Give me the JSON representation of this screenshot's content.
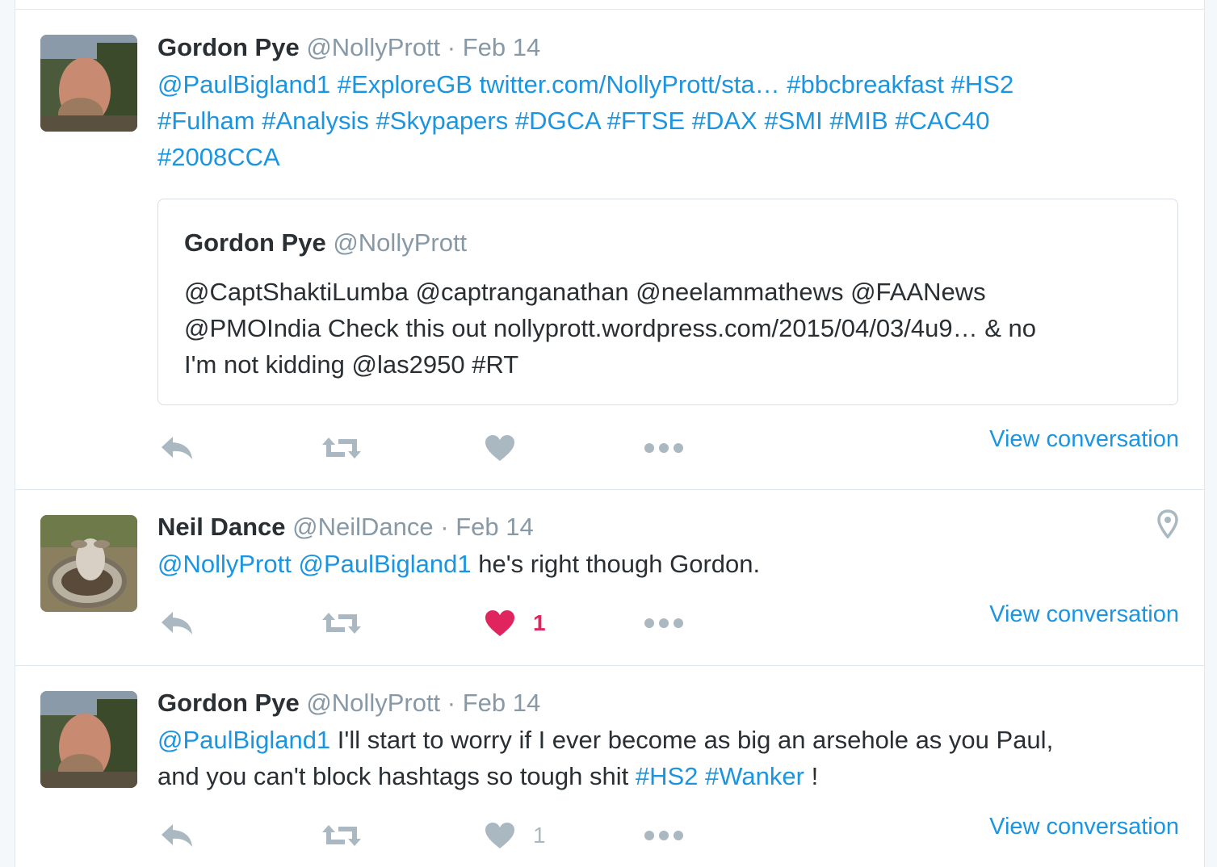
{
  "tweets": [
    {
      "fullname": "Gordon Pye",
      "username": "@NollyPrott",
      "separator": "·",
      "time": "Feb 14",
      "text_lines": [
        [
          {
            "t": "@PaulBigland1",
            "link": true
          },
          {
            "t": " ",
            "link": false
          },
          {
            "t": "#ExploreGB",
            "link": true
          },
          {
            "t": " ",
            "link": false
          },
          {
            "t": "twitter.com/NollyPrott/sta…",
            "link": true
          },
          {
            "t": " ",
            "link": false
          },
          {
            "t": "#bbcbreakfast",
            "link": true
          },
          {
            "t": " ",
            "link": false
          },
          {
            "t": "#HS2",
            "link": true
          }
        ],
        [
          {
            "t": "#Fulham",
            "link": true
          },
          {
            "t": " ",
            "link": false
          },
          {
            "t": "#Analysis",
            "link": true
          },
          {
            "t": " ",
            "link": false
          },
          {
            "t": "#Skypapers",
            "link": true
          },
          {
            "t": " ",
            "link": false
          },
          {
            "t": "#DGCA",
            "link": true
          },
          {
            "t": " ",
            "link": false
          },
          {
            "t": "#FTSE",
            "link": true
          },
          {
            "t": " ",
            "link": false
          },
          {
            "t": "#DAX",
            "link": true
          },
          {
            "t": " ",
            "link": false
          },
          {
            "t": "#SMI",
            "link": true
          },
          {
            "t": " ",
            "link": false
          },
          {
            "t": "#MIB",
            "link": true
          },
          {
            "t": " ",
            "link": false
          },
          {
            "t": "#CAC40",
            "link": true
          }
        ],
        [
          {
            "t": "#2008CCA",
            "link": true
          }
        ]
      ],
      "quote": {
        "fullname": "Gordon Pye",
        "username": "@NollyPrott",
        "lines": [
          "@CaptShaktiLumba @captranganathan @neelammathews @FAANews",
          "@PMOIndia Check this out nollyprott.wordpress.com/2015/04/03/4u9… & no",
          "I'm not kidding @las2950 #RT"
        ]
      },
      "like_count": "",
      "liked": false,
      "view_conversation": "View conversation"
    },
    {
      "fullname": "Neil Dance",
      "username": "@NeilDance",
      "separator": "·",
      "time": "Feb 14",
      "text_lines": [
        [
          {
            "t": "@NollyPrott",
            "link": true
          },
          {
            "t": " ",
            "link": false
          },
          {
            "t": "@PaulBigland1",
            "link": true
          },
          {
            "t": " he's right though Gordon.",
            "link": false
          }
        ]
      ],
      "like_count": "1",
      "liked": true,
      "has_location": true,
      "view_conversation": "View conversation"
    },
    {
      "fullname": "Gordon Pye",
      "username": "@NollyPrott",
      "separator": "·",
      "time": "Feb 14",
      "text_lines": [
        [
          {
            "t": "@PaulBigland1",
            "link": true
          },
          {
            "t": " I'll start to worry if I ever become as big an arsehole as you Paul,",
            "link": false
          }
        ],
        [
          {
            "t": "and you can't block hashtags so tough shit ",
            "link": false
          },
          {
            "t": "#HS2",
            "link": true
          },
          {
            "t": " ",
            "link": false
          },
          {
            "t": "#Wanker",
            "link": true
          },
          {
            "t": " !",
            "link": false
          }
        ]
      ],
      "like_count": "1",
      "liked": false,
      "view_conversation": "View conversation"
    }
  ],
  "icons": {
    "reply": "reply-icon",
    "retweet": "retweet-icon",
    "like": "heart-icon",
    "more": "more-dots-icon",
    "location": "location-pin-icon"
  },
  "colors": {
    "link": "#1b95e0",
    "muted": "#8899a6",
    "action_icon": "#aab8c2",
    "liked": "#e0245e",
    "text": "#292f33",
    "border": "#e1e8ed"
  }
}
